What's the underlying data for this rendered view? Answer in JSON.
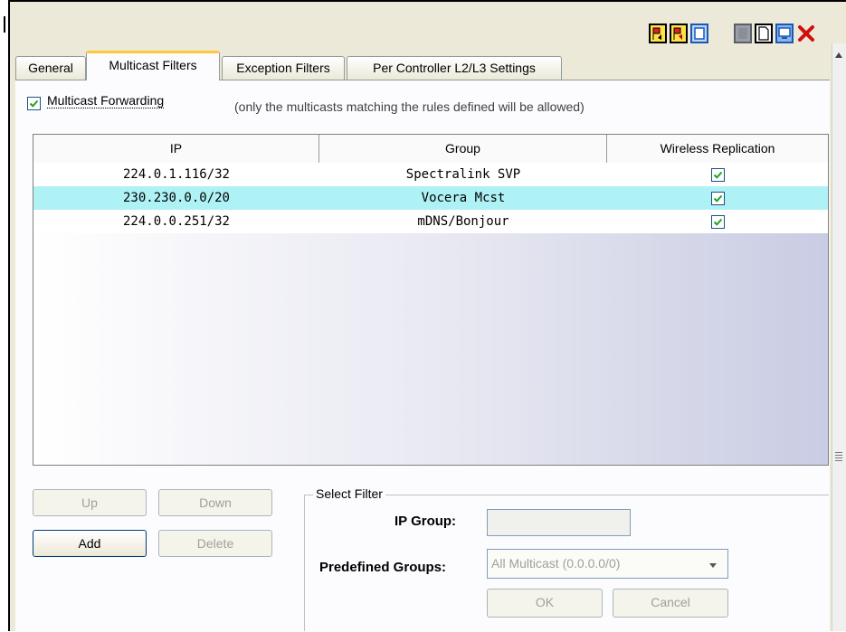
{
  "toolbar": {
    "icons": [
      "yellow-flag-up-icon",
      "yellow-flag-down-icon",
      "script-icon",
      "save-disabled-icon",
      "new-document-icon",
      "window-icon",
      "close-icon"
    ]
  },
  "tabs": [
    {
      "label": "General",
      "active": false
    },
    {
      "label": "Multicast Filters",
      "active": true
    },
    {
      "label": "Exception Filters",
      "active": false
    },
    {
      "label": "Per Controller L2/L3 Settings",
      "active": false
    }
  ],
  "multicast_forwarding": {
    "label": "Multicast Forwarding",
    "checked": true,
    "note": "(only the multicasts matching the rules defined will be allowed)"
  },
  "table": {
    "columns": [
      "IP",
      "Group",
      "Wireless Replication"
    ],
    "rows": [
      {
        "ip": "224.0.1.116/32",
        "group": "Spectralink SVP",
        "wireless_replication": true,
        "selected": false
      },
      {
        "ip": "230.230.0.0/20",
        "group": "Vocera Mcst",
        "wireless_replication": true,
        "selected": true
      },
      {
        "ip": "224.0.0.251/32",
        "group": "mDNS/Bonjour",
        "wireless_replication": true,
        "selected": false
      }
    ]
  },
  "buttons": {
    "up": "Up",
    "down": "Down",
    "add": "Add",
    "delete": "Delete"
  },
  "select_filter": {
    "title": "Select Filter",
    "ip_group_label": "IP Group:",
    "ip_group_value": "",
    "predefined_label": "Predefined Groups:",
    "predefined_value": "All Multicast (0.0.0.0/0)",
    "ok": "OK",
    "cancel": "Cancel"
  },
  "colors": {
    "selected_row": "#aef2f6",
    "active_tab_accent": "#ffc83c",
    "panel_bg": "#ece9d8"
  }
}
